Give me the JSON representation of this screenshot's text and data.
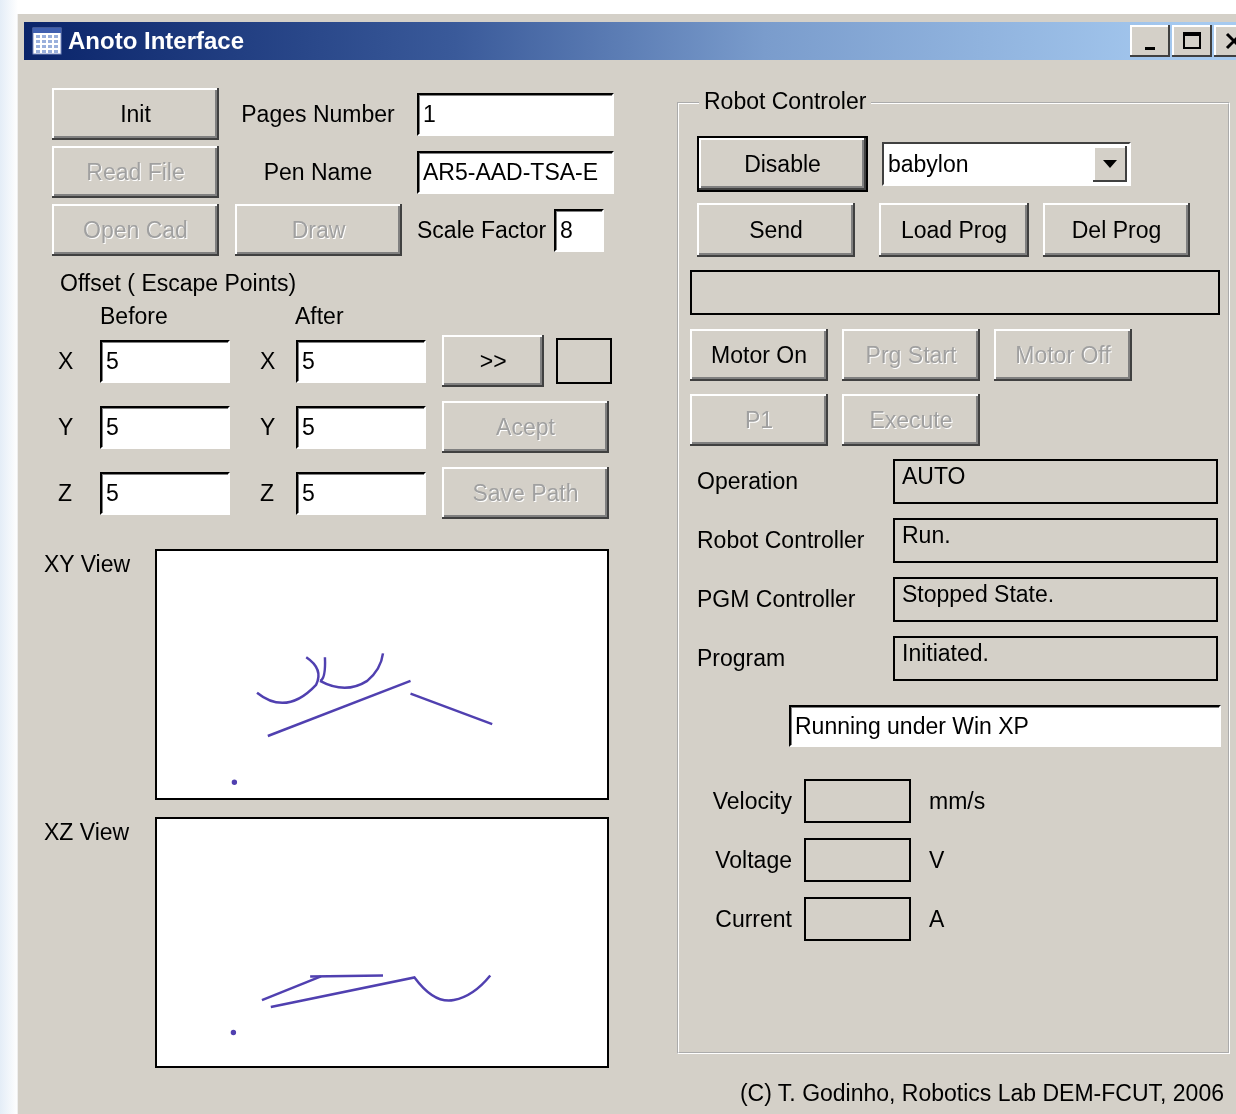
{
  "window": {
    "title": "Anoto Interface"
  },
  "pen": {
    "init": {
      "label": "Init",
      "disabled": false
    },
    "read_file": {
      "label": "Read File",
      "disabled": true
    },
    "open_cad": {
      "label": "Open Cad",
      "disabled": true
    },
    "draw": {
      "label": "Draw",
      "disabled": true
    },
    "pages_number": {
      "label": "Pages Number",
      "value": "1"
    },
    "pen_name": {
      "label": "Pen Name",
      "value": "AR5-AAD-TSA-E"
    },
    "scale_factor": {
      "label": "Scale Factor",
      "value": "8"
    }
  },
  "offset": {
    "title": "Offset ( Escape Points)",
    "before_label": "Before",
    "after_label": "After",
    "rows": [
      {
        "axis": "X",
        "before": "5",
        "after_axis": "X",
        "after": "5"
      },
      {
        "axis": "Y",
        "before": "5",
        "after_axis": "Y",
        "after": "5"
      },
      {
        "axis": "Z",
        "before": "5",
        "after_axis": "Z",
        "after": "5"
      }
    ],
    "transfer": {
      "label": ">>",
      "disabled": false
    },
    "accept": {
      "label": "Acept",
      "disabled": true
    },
    "save_path": {
      "label": "Save Path",
      "disabled": true
    }
  },
  "views": [
    {
      "label": "XY View",
      "kind": "xy"
    },
    {
      "label": "XZ View",
      "kind": "xz"
    }
  ],
  "robot": {
    "title": "Robot Controler",
    "mode_button": {
      "label": "Disable",
      "default": true
    },
    "robot_select": {
      "value": "babylon"
    },
    "program_buttons": [
      {
        "label": "Send",
        "disabled": false
      },
      {
        "label": "Load Prog",
        "disabled": false
      },
      {
        "label": "Del Prog",
        "disabled": false
      }
    ],
    "motor_buttons": [
      {
        "label": "Motor On",
        "disabled": false
      },
      {
        "label": "Prg Start",
        "disabled": true
      },
      {
        "label": "Motor Off",
        "disabled": true
      },
      {
        "label": "P1",
        "disabled": true
      },
      {
        "label": "Execute",
        "disabled": true
      }
    ],
    "status": [
      {
        "label": "Operation",
        "value": "AUTO"
      },
      {
        "label": "Robot Controller",
        "value": "Run."
      },
      {
        "label": "PGM Controller",
        "value": "Stopped State."
      },
      {
        "label": "Program",
        "value": "Initiated."
      }
    ],
    "os_info": "Running under Win XP",
    "readings": [
      {
        "label": "Velocity",
        "unit": "mm/s"
      },
      {
        "label": "Voltage",
        "unit": "V"
      },
      {
        "label": "Current",
        "unit": "A"
      }
    ]
  },
  "footer": "(C) T. Godinho, Robotics Lab DEM-FCUT, 2006"
}
